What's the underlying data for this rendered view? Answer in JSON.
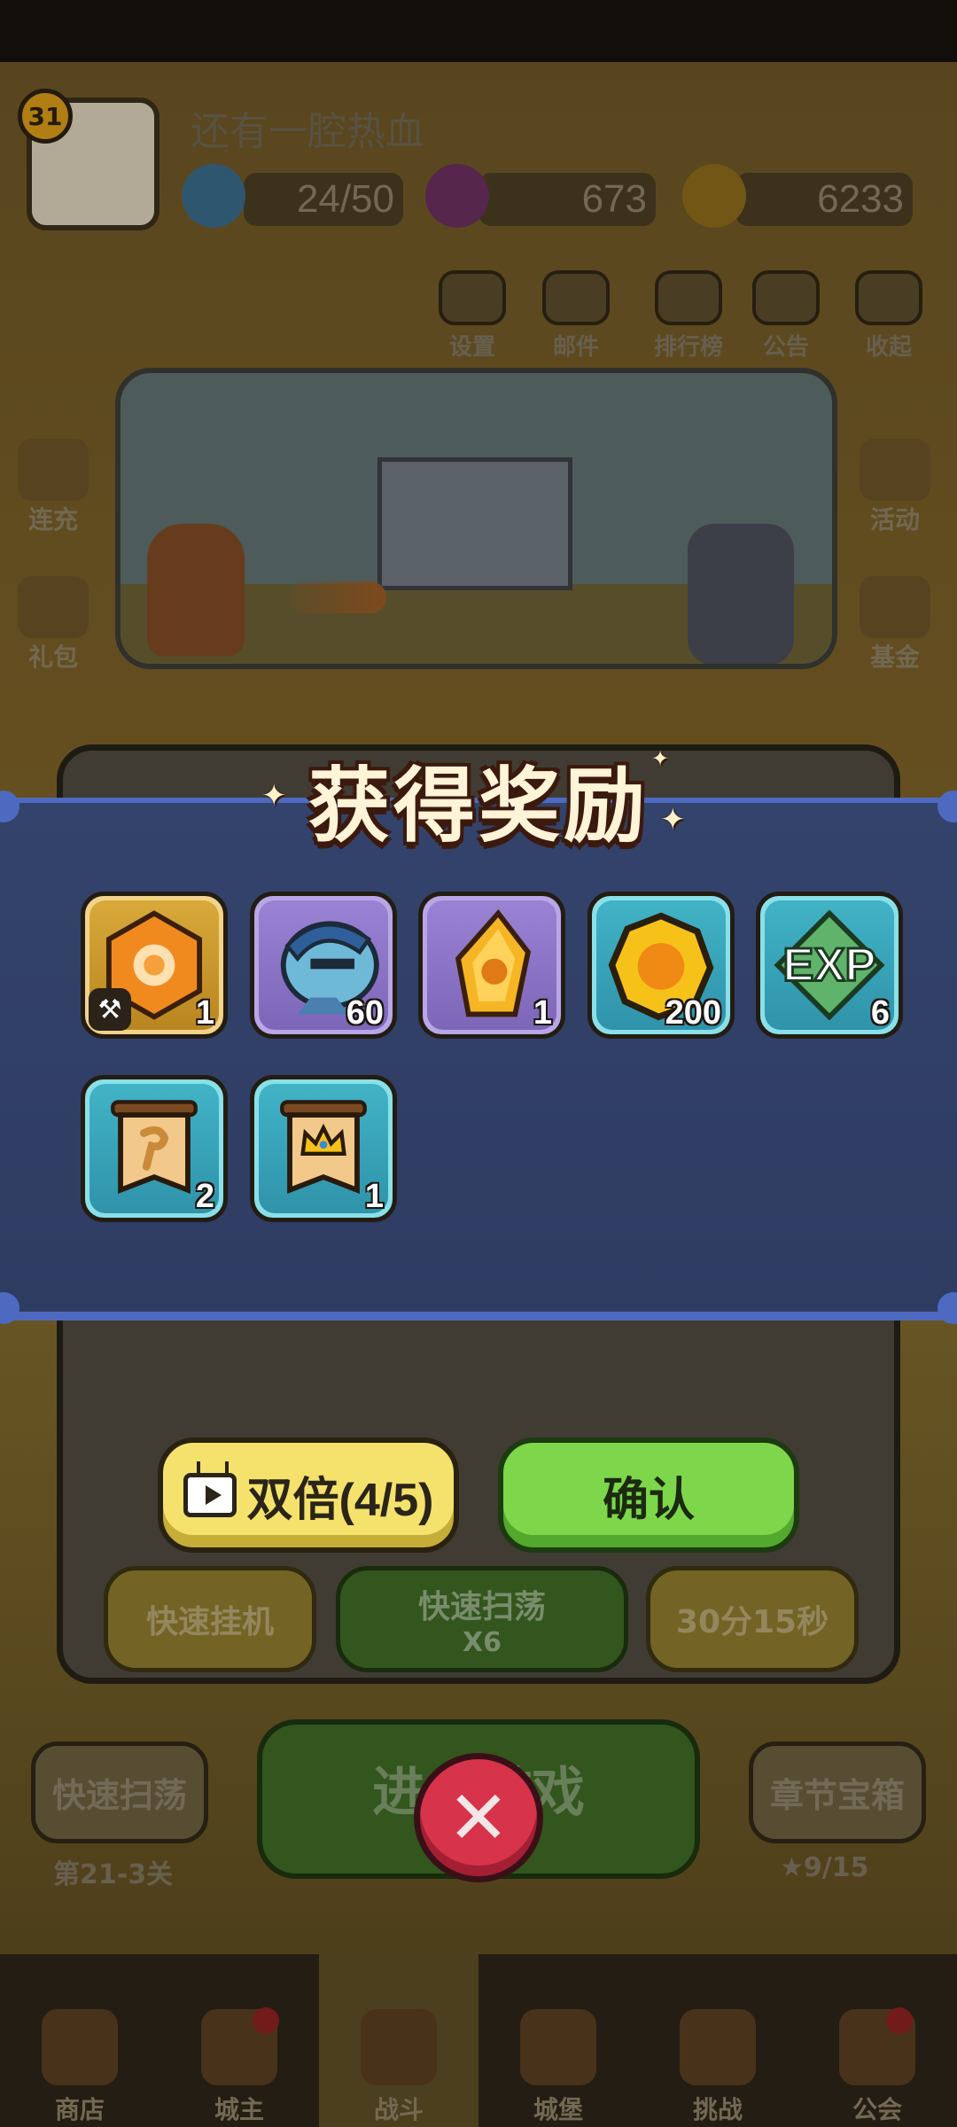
{
  "player": {
    "level": "31",
    "name": "还有一腔热血"
  },
  "resources": {
    "energy": "24/50",
    "gems": "673",
    "coins": "6233"
  },
  "top_menu": [
    {
      "label": "设置",
      "icon": "gear-icon"
    },
    {
      "label": "邮件",
      "icon": "mail-icon"
    },
    {
      "label": "排行榜",
      "icon": "leaderboard-icon"
    },
    {
      "label": "公告",
      "icon": "megaphone-icon"
    },
    {
      "label": "收起",
      "icon": "collapse-icon"
    }
  ],
  "side_menu": {
    "left": [
      "连充",
      "礼包"
    ],
    "right": [
      "活动",
      "基金"
    ]
  },
  "reward": {
    "title": "获得奖励",
    "items": [
      {
        "icon": "relic-gem-icon",
        "qty": "1",
        "frame": "gold",
        "badge": "hammer"
      },
      {
        "icon": "hero-shard-icon",
        "qty": "60",
        "frame": "purple"
      },
      {
        "icon": "fire-crystal-icon",
        "qty": "1",
        "frame": "purple"
      },
      {
        "icon": "gold-coin-icon",
        "qty": "200",
        "frame": "teal"
      },
      {
        "icon": "exp-icon",
        "qty": "6",
        "frame": "teal",
        "text": "EXP"
      },
      {
        "icon": "hammer-scroll-icon",
        "qty": "2",
        "frame": "teal"
      },
      {
        "icon": "crown-scroll-icon",
        "qty": "1",
        "frame": "teal"
      }
    ]
  },
  "buttons": {
    "double": "双倍(4/5)",
    "confirm": "确认"
  },
  "panel_buttons": {
    "quick_idle": "快速挂机",
    "quick_sweep": "快速扫荡",
    "sweep_cost": "X6",
    "timer": "30分15秒"
  },
  "bottom_area": {
    "quick_sweep": "快速扫荡",
    "stage": "第21-3关",
    "enter": "进入游戏",
    "chapter_chest": "章节宝箱",
    "stars": "9/15"
  },
  "nav": [
    {
      "label": "商店",
      "icon": "shop-icon"
    },
    {
      "label": "城主",
      "icon": "lord-icon"
    },
    {
      "label": "战斗",
      "icon": "battle-icon",
      "active": true
    },
    {
      "label": "城堡",
      "icon": "castle-icon"
    },
    {
      "label": "挑战",
      "icon": "challenge-icon"
    },
    {
      "label": "公会",
      "icon": "guild-icon"
    }
  ],
  "colors": {
    "banner": "#324067",
    "banner_border": "#4d6ac0",
    "confirm_green": "#7ed74b",
    "double_yellow": "#f4e26c",
    "close_red": "#d7334a"
  }
}
